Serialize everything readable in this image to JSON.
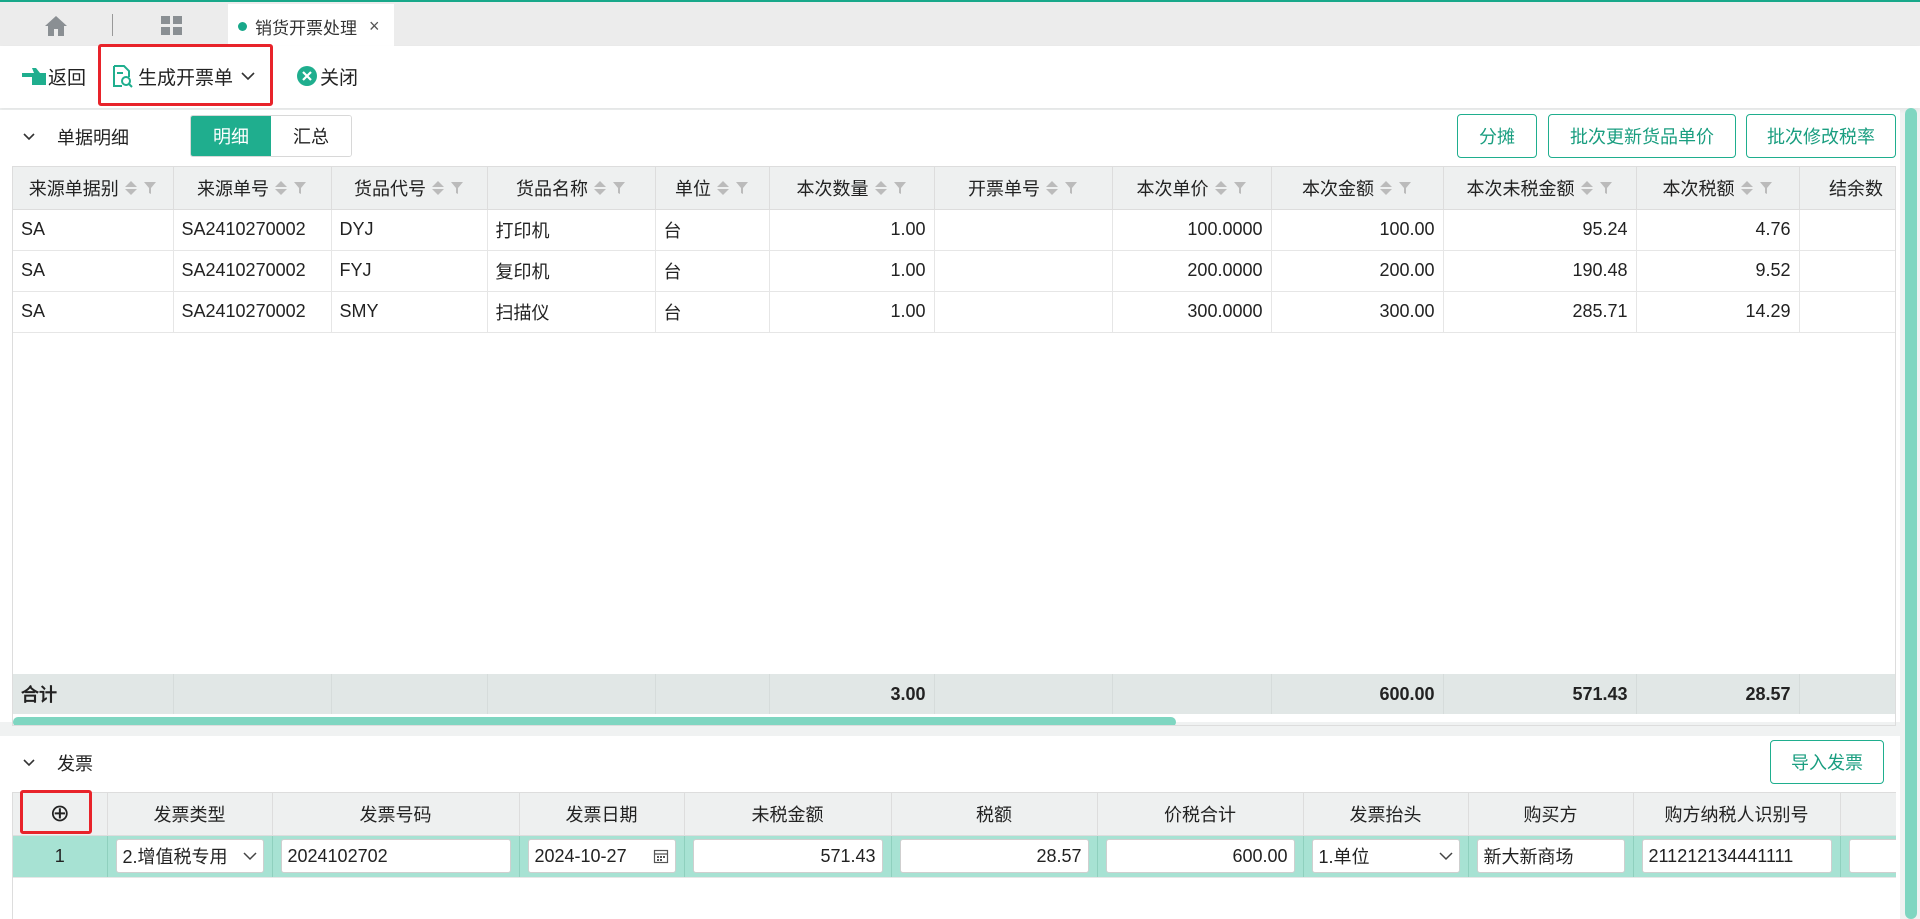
{
  "topbar": {
    "tab_title": "销货开票处理",
    "tab_close": "×"
  },
  "toolbar": {
    "back_label": "返回",
    "generate_label": "生成开票单",
    "close_label": "关闭"
  },
  "detail_section": {
    "title": "单据明细",
    "segments": [
      "明细",
      "汇总"
    ],
    "active_segment": "明细",
    "actions": [
      "分摊",
      "批次更新货品单价",
      "批次修改税率"
    ],
    "columns": [
      "来源单据别",
      "来源单号",
      "货品代号",
      "货品名称",
      "单位",
      "本次数量",
      "开票单号",
      "本次单价",
      "本次金额",
      "本次未税金额",
      "本次税额",
      "结余数"
    ],
    "rows": [
      [
        "SA",
        "SA2410270002",
        "DYJ",
        "打印机",
        "台",
        "1.00",
        "",
        "100.0000",
        "100.00",
        "95.24",
        "4.76",
        ""
      ],
      [
        "SA",
        "SA2410270002",
        "FYJ",
        "复印机",
        "台",
        "1.00",
        "",
        "200.0000",
        "200.00",
        "190.48",
        "9.52",
        ""
      ],
      [
        "SA",
        "SA2410270002",
        "SMY",
        "扫描仪",
        "台",
        "1.00",
        "",
        "300.0000",
        "300.00",
        "285.71",
        "14.29",
        ""
      ]
    ],
    "summary": {
      "label": "合计",
      "qty": "3.00",
      "amount": "600.00",
      "untaxed": "571.43",
      "tax": "28.57"
    }
  },
  "invoice_section": {
    "title": "发票",
    "import_label": "导入发票",
    "add_symbol": "⊕",
    "columns": [
      "发票类型",
      "发票号码",
      "发票日期",
      "未税金额",
      "税额",
      "价税合计",
      "发票抬头",
      "购买方",
      "购方纳税人识别号"
    ],
    "row": {
      "index": "1",
      "type": "2.增值税专用",
      "number": "2024102702",
      "date": "2024-10-27",
      "untaxed": "571.43",
      "tax": "28.57",
      "total": "600.00",
      "header": "1.单位",
      "buyer": "新大新商场",
      "taxpayer_id": "211212134441111"
    }
  },
  "colors": {
    "accent": "#1fae8e",
    "highlight": "#e8232a"
  }
}
